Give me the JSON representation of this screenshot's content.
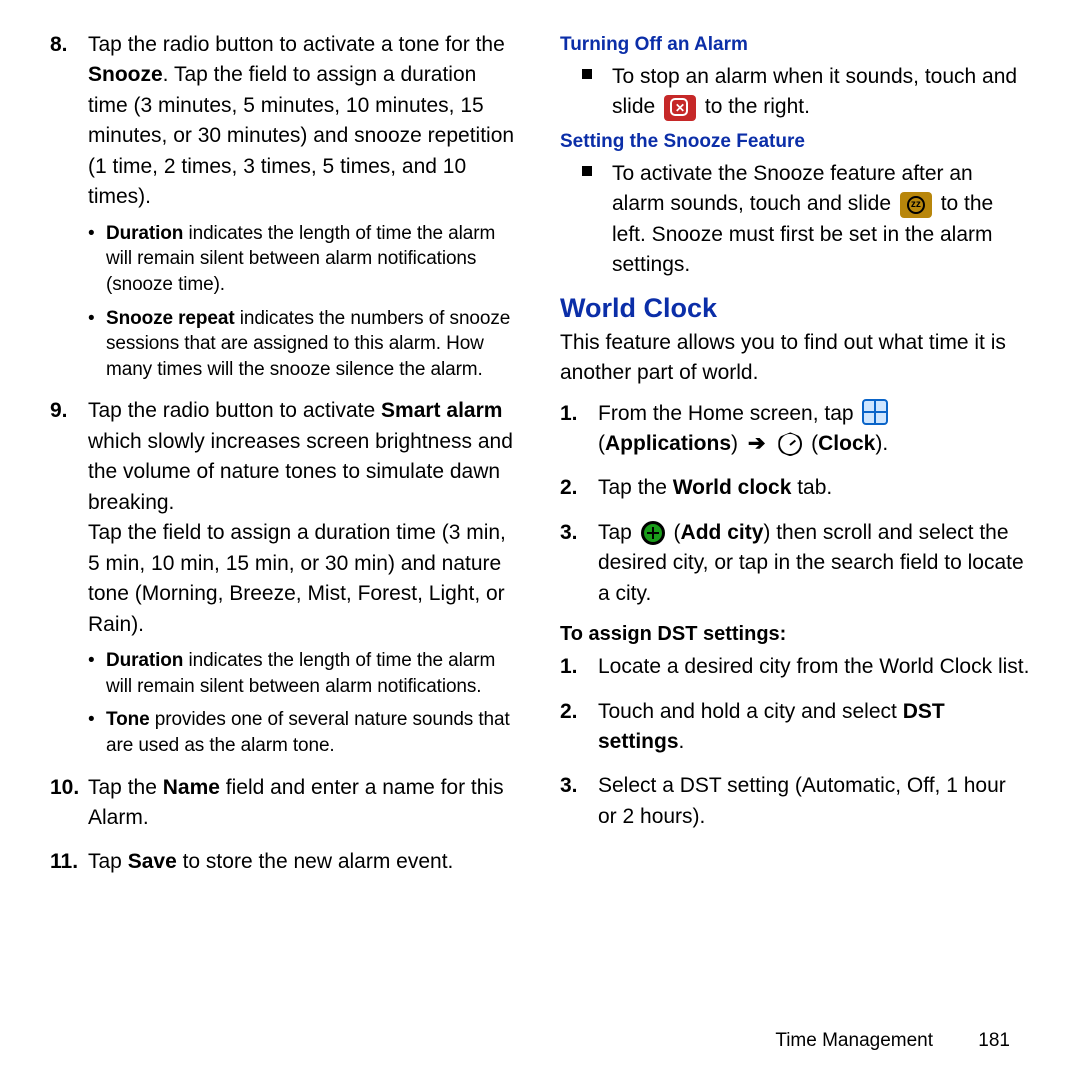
{
  "left": {
    "items": [
      {
        "num": "8.",
        "html": "Tap the radio button to activate a tone for the <b>Snooze</b>. Tap the field to assign a duration time (3 minutes, 5 minutes, 10 minutes, 15 minutes, or 30 minutes) and snooze repetition (1 time, 2 times, 3 times, 5 times, and 10 times).",
        "sub": [
          "<b>Duration</b> indicates the length of time the alarm will remain silent between alarm notifications (snooze time).",
          "<b>Snooze repeat</b> indicates the numbers of snooze sessions that are assigned to this alarm. How many times will the snooze silence the alarm."
        ]
      },
      {
        "num": "9.",
        "html": "Tap the radio button to activate <b>Smart alarm</b> which slowly increases screen brightness and the volume of nature tones to simulate dawn breaking.<br>Tap the field to assign a duration time (3 min, 5 min, 10 min, 15 min, or 30 min) and nature tone (Morning, Breeze, Mist, Forest, Light, or Rain).",
        "sub": [
          "<b>Duration</b> indicates the length of time the alarm will remain silent between alarm notifications.",
          "<b>Tone</b> provides one of several nature sounds that are used as the alarm tone."
        ]
      },
      {
        "num": "10.",
        "html": "Tap the <b>Name</b> field and enter a name for this Alarm."
      },
      {
        "num": "11.",
        "html": "Tap <b>Save</b> to store the new alarm event."
      }
    ]
  },
  "right": {
    "turning_off_heading": "Turning Off an Alarm",
    "turning_off_pre": "To stop an alarm when it sounds, touch and slide ",
    "turning_off_post": " to the right.",
    "snooze_heading": "Setting the Snooze Feature",
    "snooze_pre": "To activate the Snooze feature after an alarm sounds, touch and slide ",
    "snooze_post": " to the left. Snooze must first be set in the alarm settings.",
    "world_clock_heading": "World Clock",
    "world_clock_intro": "This feature allows you to find out what time it is another part of world.",
    "wc_steps": [
      {
        "num": "1.",
        "pre": "From the Home screen, tap ",
        "mid1": "(<b>Applications</b>) ",
        "mid2": " (<b>Clock</b>)."
      },
      {
        "num": "2.",
        "html": "Tap the <b>World clock</b> tab."
      },
      {
        "num": "3.",
        "pre": "Tap ",
        "post": " (<b>Add city</b>) then scroll and select the desired city, or tap in the search field to locate a city."
      }
    ],
    "dst_heading": "To assign DST settings:",
    "dst_steps": [
      {
        "num": "1.",
        "html": "Locate a desired city from the World Clock list."
      },
      {
        "num": "2.",
        "html": "Touch and hold a city and select <b>DST settings</b>."
      },
      {
        "num": "3.",
        "html": "Select a DST setting (Automatic, Off, 1 hour or 2 hours)."
      }
    ]
  },
  "footer": {
    "section": "Time Management",
    "page": "181"
  }
}
